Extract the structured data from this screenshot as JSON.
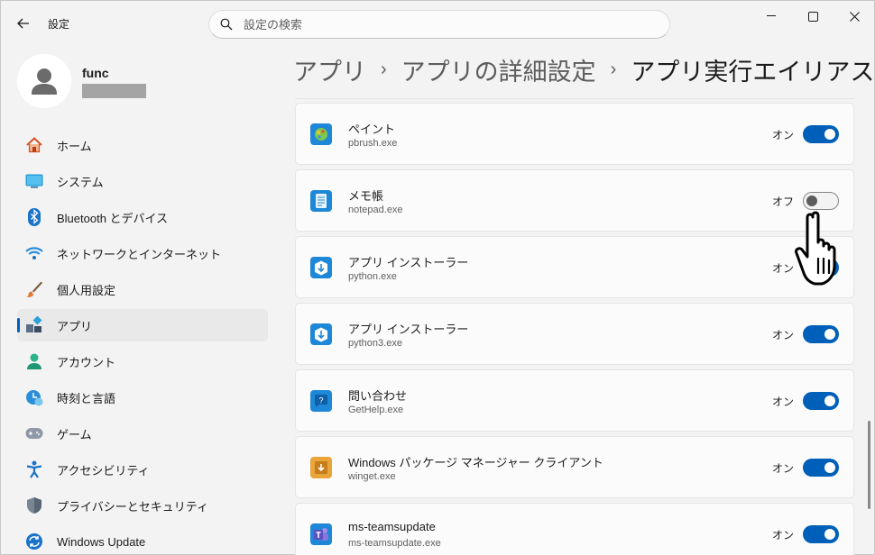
{
  "app": {
    "title": "設定"
  },
  "search": {
    "placeholder": "設定の検索"
  },
  "user": {
    "name": "func"
  },
  "nav": {
    "items": [
      {
        "label": "ホーム",
        "icon": "home-icon",
        "active": false
      },
      {
        "label": "システム",
        "icon": "system-icon",
        "active": false
      },
      {
        "label": "Bluetooth とデバイス",
        "icon": "bluetooth-icon",
        "active": false
      },
      {
        "label": "ネットワークとインターネット",
        "icon": "wifi-icon",
        "active": false
      },
      {
        "label": "個人用設定",
        "icon": "brush-icon",
        "active": false
      },
      {
        "label": "アプリ",
        "icon": "apps-icon",
        "active": true
      },
      {
        "label": "アカウント",
        "icon": "account-icon",
        "active": false
      },
      {
        "label": "時刻と言語",
        "icon": "time-language-icon",
        "active": false
      },
      {
        "label": "ゲーム",
        "icon": "gamepad-icon",
        "active": false
      },
      {
        "label": "アクセシビリティ",
        "icon": "accessibility-icon",
        "active": false
      },
      {
        "label": "プライバシーとセキュリティ",
        "icon": "shield-icon",
        "active": false
      },
      {
        "label": "Windows Update",
        "icon": "update-icon",
        "active": false
      }
    ]
  },
  "breadcrumb": {
    "items": [
      "アプリ",
      "アプリの詳細設定",
      "アプリ実行エイリアス"
    ]
  },
  "aliases": [
    {
      "name": "ペイント",
      "exe": "pbrush.exe",
      "state": "オン",
      "enabled": true,
      "icon": "paint-icon"
    },
    {
      "name": "メモ帳",
      "exe": "notepad.exe",
      "state": "オフ",
      "enabled": false,
      "icon": "notepad-icon"
    },
    {
      "name": "アプリ インストーラー",
      "exe": "python.exe",
      "state": "オン",
      "enabled": true,
      "icon": "app-installer-icon"
    },
    {
      "name": "アプリ インストーラー",
      "exe": "python3.exe",
      "state": "オン",
      "enabled": true,
      "icon": "app-installer-icon"
    },
    {
      "name": "問い合わせ",
      "exe": "GetHelp.exe",
      "state": "オン",
      "enabled": true,
      "icon": "get-help-icon"
    },
    {
      "name": "Windows パッケージ マネージャー クライアント",
      "exe": "winget.exe",
      "state": "オン",
      "enabled": true,
      "icon": "winget-icon"
    },
    {
      "name": "ms-teamsupdate",
      "exe": "ms-teamsupdate.exe",
      "state": "オン",
      "enabled": true,
      "icon": "teams-icon"
    }
  ],
  "colors": {
    "accent": "#005fb8",
    "background": "#f3f3f3",
    "card": "#fbfbfb"
  }
}
